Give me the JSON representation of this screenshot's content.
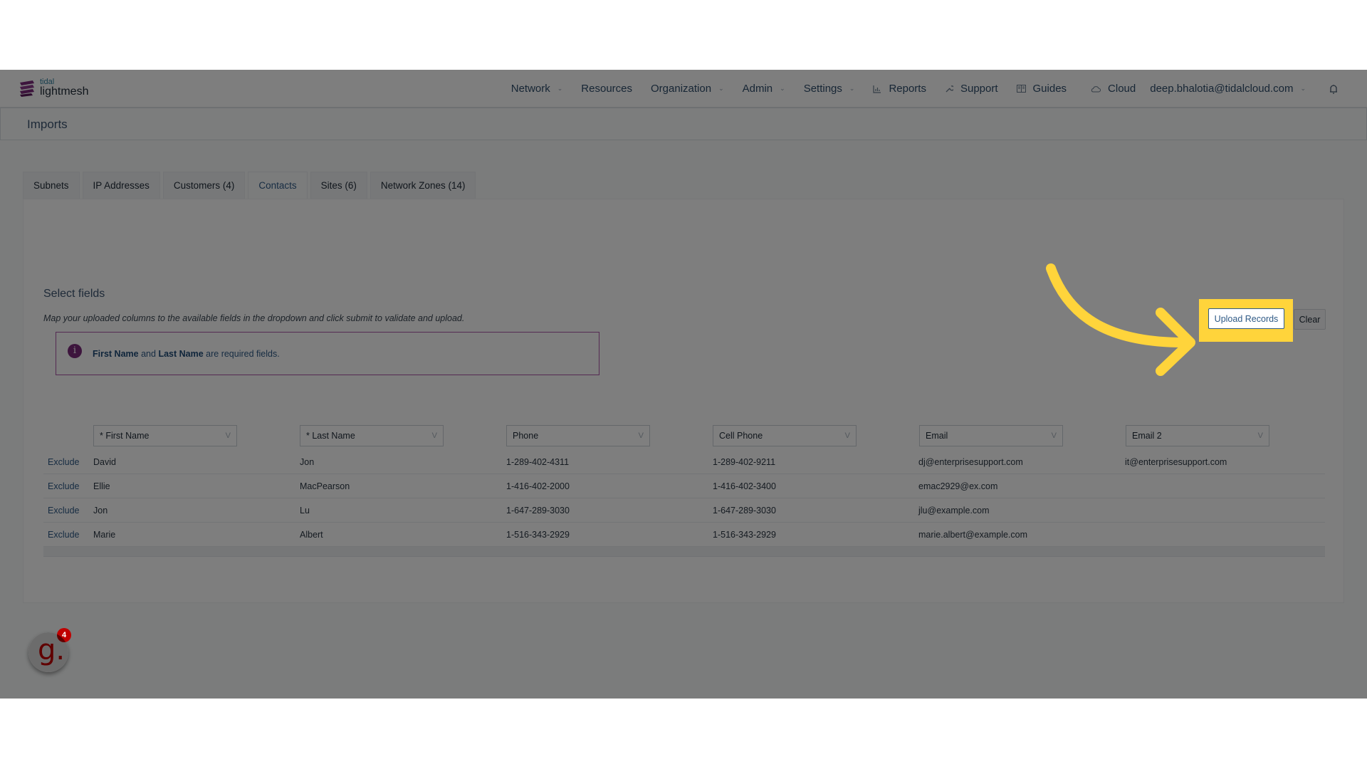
{
  "brand": {
    "small": "tidal",
    "big": "lightmesh"
  },
  "nav": {
    "items": [
      {
        "label": "Network",
        "dropdown": true,
        "icon": null
      },
      {
        "label": "Resources",
        "dropdown": false,
        "icon": null
      },
      {
        "label": "Organization",
        "dropdown": true,
        "icon": null
      },
      {
        "label": "Admin",
        "dropdown": true,
        "icon": null
      },
      {
        "label": "Settings",
        "dropdown": true,
        "icon": null
      },
      {
        "label": "Reports",
        "dropdown": false,
        "icon": "bar-chart-icon"
      },
      {
        "label": "Support",
        "dropdown": false,
        "icon": "wrench-icon"
      },
      {
        "label": "Guides",
        "dropdown": false,
        "icon": "book-icon"
      },
      {
        "label": "Cloud",
        "dropdown": false,
        "icon": "cloud-icon"
      }
    ],
    "user_email": "deep.bhalotia@tidalcloud.com",
    "chevron": "⌄",
    "bell_icon": "bell-icon"
  },
  "page": {
    "title": "Imports"
  },
  "tabs": [
    {
      "label": "Subnets",
      "active": false
    },
    {
      "label": "IP Addresses",
      "active": false
    },
    {
      "label": "Customers (4)",
      "active": false
    },
    {
      "label": "Contacts",
      "active": true
    },
    {
      "label": "Sites (6)",
      "active": false
    },
    {
      "label": "Network Zones (14)",
      "active": false
    }
  ],
  "section": {
    "title": "Select fields",
    "description": "Map your uploaded columns to the available fields in the dropdown and click submit to validate and upload."
  },
  "alert": {
    "field1": "First Name",
    "and": "and",
    "field2": "Last Name",
    "suffix": "are required fields.",
    "icon": "i"
  },
  "buttons": {
    "upload": "Upload Records",
    "clear": "Clear"
  },
  "table": {
    "column_selects": [
      "* First Name",
      "* Last Name",
      "Phone",
      "Cell Phone",
      "Email",
      "Email 2"
    ],
    "exclude_label": "Exclude",
    "rows": [
      {
        "first": "David",
        "last": "Jon",
        "phone": "1-289-402-4311",
        "cell": "1-289-402-9211",
        "email": "dj@enterprisesupport.com",
        "email2": "it@enterprisesupport.com"
      },
      {
        "first": "Ellie",
        "last": "MacPearson",
        "phone": "1-416-402-2000",
        "cell": "1-416-402-3400",
        "email": "emac2929@ex.com",
        "email2": ""
      },
      {
        "first": "Jon",
        "last": "Lu",
        "phone": "1-647-289-3030",
        "cell": "1-647-289-3030",
        "email": "jlu@example.com",
        "email2": ""
      },
      {
        "first": "Marie",
        "last": "Albert",
        "phone": "1-516-343-2929",
        "cell": "1-516-343-2929",
        "email": "marie.albert@example.com",
        "email2": ""
      }
    ]
  },
  "guide_widget": {
    "letter": "g.",
    "count": "4"
  },
  "colors": {
    "highlight": "#ffd43b",
    "brand_purple": "#7a2a7a",
    "link": "#2f5a86",
    "badge_red": "#c00000"
  }
}
